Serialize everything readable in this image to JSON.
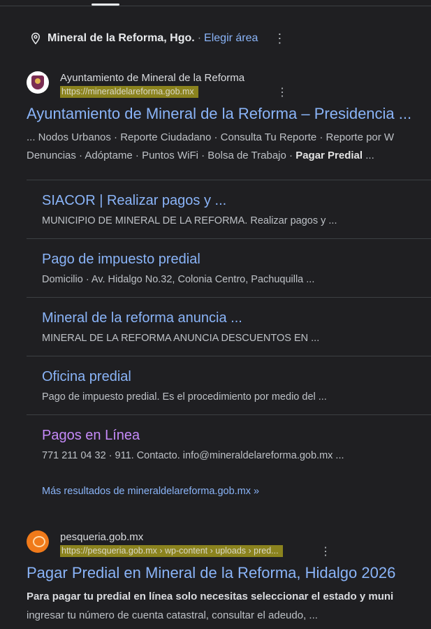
{
  "location": {
    "place": "Mineral de la Reforma, Hgo.",
    "separator": "·",
    "change_label": "Elegir área"
  },
  "results": [
    {
      "site_name": "Ayuntamiento de Mineral de la Reforma",
      "url": "https://mineraldelareforma.gob.mx",
      "title": "Ayuntamiento de Mineral de la Reforma – Presidencia ...",
      "snippet_line1": "... Nodos Urbanos · Reporte Ciudadano · Consulta Tu Reporte · Reporte por W",
      "snippet_line2_plain": "Denuncias · Adóptame · Puntos WiFi · Bolsa de Trabajo · ",
      "snippet_line2_bold": "Pagar Predial",
      "snippet_line2_tail": " ...",
      "sitelinks": [
        {
          "title": "SIACOR | Realizar pagos y ...",
          "snippet": "MUNICIPIO DE MINERAL DE LA REFORMA. Realizar pagos y ..."
        },
        {
          "title": "Pago de impuesto predial",
          "snippet": "Domicilio · Av. Hidalgo No.32, Colonia Centro, Pachuquilla ..."
        },
        {
          "title": "Mineral de la reforma anuncia ...",
          "snippet": "MINERAL DE LA REFORMA ANUNCIA DESCUENTOS EN ..."
        },
        {
          "title": "Oficina predial",
          "snippet": "Pago de impuesto predial. Es el procedimiento por medio del ..."
        },
        {
          "title": "Pagos en Línea",
          "snippet": "771 211 04 32 · 911. Contacto. info@mineraldelareforma.gob.mx ..."
        }
      ],
      "more_results": "Más resultados de mineraldelareforma.gob.mx »"
    },
    {
      "site_name": "pesqueria.gob.mx",
      "url": "https://pesqueria.gob.mx › wp-content › uploads › pred...",
      "title": "Pagar Predial en Mineral de la Reforma, Hidalgo 2026",
      "snippet_line1": "Para pagar tu predial en línea solo necesitas seleccionar el estado y muni",
      "snippet_line2": "ingresar tu número de cuenta catastral, consultar el adeudo, ..."
    }
  ],
  "icons": {
    "location": "map-pin-icon",
    "menu": "more-vert-icon",
    "favicon1": "municipal-crest-favicon",
    "favicon2": "pesqueria-favicon"
  },
  "colors": {
    "background": "#1f1f22",
    "link": "#8ab4f8",
    "visited_link": "#c58af9",
    "text": "#bdc1c6",
    "highlight": "#aaa01e"
  }
}
